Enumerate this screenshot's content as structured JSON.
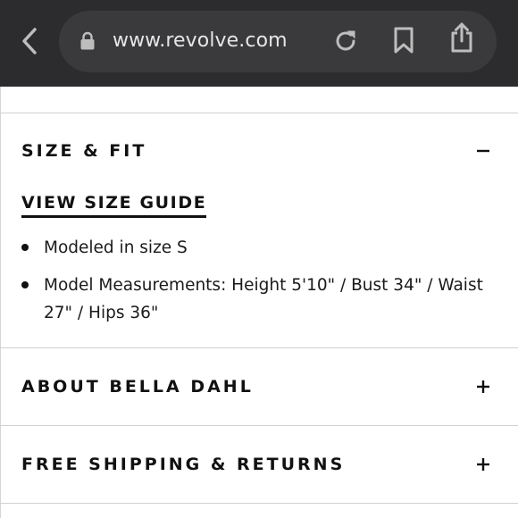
{
  "browser": {
    "url": "www.revolve.com",
    "icons": [
      "chevron-left-icon",
      "lock-icon",
      "reload-icon",
      "bookmark-icon",
      "share-icon"
    ]
  },
  "size_fit": {
    "title": "SIZE & FIT",
    "toggle": "−",
    "size_guide_link": "VIEW SIZE GUIDE",
    "details": [
      "Modeled in size S",
      "Model Measurements: Height 5'10\" / Bust 34\" / Waist 27\" / Hips 36\""
    ]
  },
  "sections": [
    {
      "title": "ABOUT BELLA DAHL",
      "toggle": "+"
    },
    {
      "title": "FREE SHIPPING & RETURNS",
      "toggle": "+"
    }
  ],
  "colors": {
    "toolbar": "#2c2c2e",
    "url_pill": "#3a3a3c",
    "text": "#111111",
    "divider": "#d0d0d0"
  }
}
